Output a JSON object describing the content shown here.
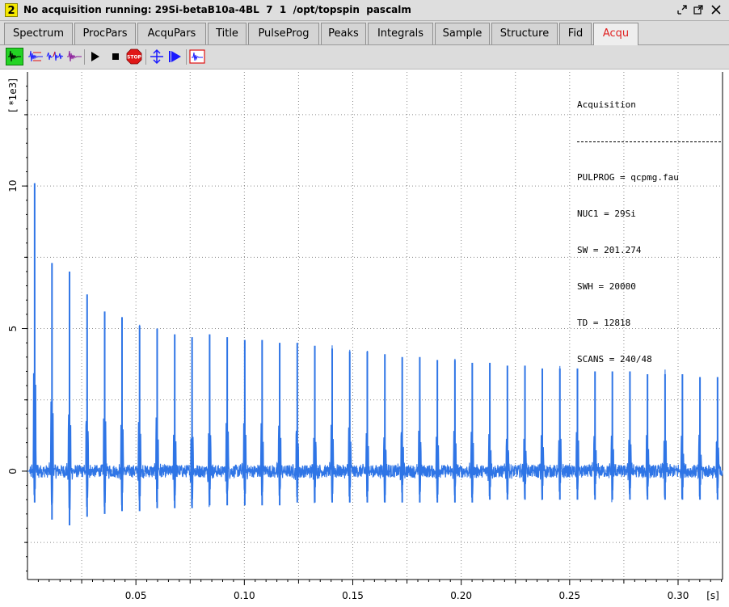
{
  "window": {
    "number": "2",
    "title": "No acquisition running: 29Si-betaB10a-4BL  7  1  /opt/topspin  pascalm"
  },
  "tabs": [
    {
      "label": "Spectrum",
      "active": false
    },
    {
      "label": "ProcPars",
      "active": false
    },
    {
      "label": "AcquPars",
      "active": false
    },
    {
      "label": "Title",
      "active": false
    },
    {
      "label": "PulseProg",
      "active": false
    },
    {
      "label": "Peaks",
      "active": false
    },
    {
      "label": "Integrals",
      "active": false
    },
    {
      "label": "Sample",
      "active": false
    },
    {
      "label": "Structure",
      "active": false
    },
    {
      "label": "Fid",
      "active": false
    },
    {
      "label": "Acqu",
      "active": true
    }
  ],
  "toolbar": {
    "icons": [
      "fid-view-active-icon",
      "fid-view-red-icon",
      "fid-view-multi-icon",
      "fid-view-purple-icon",
      "play-icon",
      "stop-square-icon",
      "stop-sign-icon",
      "adjust-icon",
      "arrow-split-icon",
      "window-fid-icon"
    ]
  },
  "info_box": {
    "heading": "Acquisition",
    "lines": [
      "PULPROG = qcpmg.fau",
      "NUC1 = 29Si",
      "SW = 201.274",
      "SWH = 20000",
      "TD = 12818",
      "SCANS = 240/48"
    ]
  },
  "colors": {
    "fid_line": "#2f75e6",
    "active_tab_text": "#e02020",
    "winnum_bg": "#f5e800"
  },
  "chart_data": {
    "type": "line",
    "title": "",
    "ylabel": "[ *1e3]",
    "xlabel": "[s]",
    "xlim": [
      0.0,
      0.3205
    ],
    "ylim": [
      -3.8,
      14.0
    ],
    "x_ticks": [
      0.05,
      0.1,
      0.15,
      0.2,
      0.25,
      0.3
    ],
    "x_tick_labels": [
      "0.05",
      "0.10",
      "0.15",
      "0.20",
      "0.25",
      "0.30"
    ],
    "y_ticks": [
      0,
      5,
      10
    ],
    "y_tick_labels": [
      "0",
      "5",
      "10"
    ],
    "grid": true,
    "series": [
      {
        "echo_times": [
          0.0033,
          0.0113,
          0.0194,
          0.0275,
          0.0356,
          0.0436,
          0.0517,
          0.0598,
          0.0679,
          0.0759,
          0.084,
          0.0921,
          0.1002,
          0.1082,
          0.1163,
          0.1244,
          0.1325,
          0.1405,
          0.1486,
          0.1567,
          0.1648,
          0.1728,
          0.1809,
          0.189,
          0.1971,
          0.2051,
          0.2132,
          0.2213,
          0.2294,
          0.2374,
          0.2455,
          0.2536,
          0.2617,
          0.2697,
          0.2778,
          0.2859,
          0.294,
          0.302,
          0.3101,
          0.3182
        ],
        "echo_max": [
          10.1,
          7.3,
          7.0,
          6.2,
          5.6,
          5.4,
          5.1,
          5.0,
          4.8,
          4.7,
          4.8,
          4.7,
          4.6,
          4.6,
          4.5,
          4.5,
          4.4,
          4.3,
          4.2,
          4.2,
          4.1,
          4.0,
          4.0,
          3.9,
          3.9,
          3.8,
          3.8,
          3.7,
          3.7,
          3.6,
          3.6,
          3.6,
          3.5,
          3.5,
          3.5,
          3.4,
          3.4,
          3.4,
          3.3,
          3.3
        ],
        "echo_min": [
          -1.1,
          -1.7,
          -1.9,
          -1.6,
          -1.5,
          -1.4,
          -1.4,
          -1.3,
          -1.3,
          -1.3,
          -1.2,
          -1.2,
          -1.2,
          -1.2,
          -1.2,
          -1.1,
          -1.1,
          -1.1,
          -1.1,
          -1.1,
          -1.1,
          -1.1,
          -1.1,
          -1.1,
          -1.1,
          -1.1,
          -1.0,
          -1.0,
          -1.0,
          -1.0,
          -1.0,
          -1.0,
          -1.0,
          -1.0,
          -1.0,
          -1.0,
          -1.0,
          -1.0,
          -1.0,
          -1.0
        ],
        "baseline": 0
      }
    ]
  }
}
